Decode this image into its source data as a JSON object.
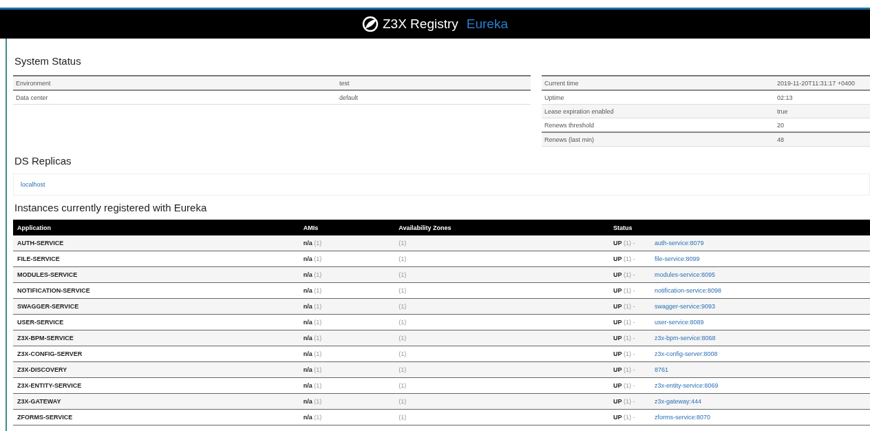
{
  "header": {
    "brand": "Z3X Registry",
    "product": "Eureka"
  },
  "system_status": {
    "title": "System Status",
    "left": [
      {
        "label": "Environment",
        "value": "test"
      },
      {
        "label": "Data center",
        "value": "default"
      }
    ],
    "right": [
      {
        "label": "Current time",
        "value": "2019-11-20T11:31:17 +0400"
      },
      {
        "label": "Uptime",
        "value": "02:13"
      },
      {
        "label": "Lease expiration enabled",
        "value": "true"
      },
      {
        "label": "Renews threshold",
        "value": "20"
      },
      {
        "label": "Renews (last min)",
        "value": "48"
      }
    ]
  },
  "replicas": {
    "title": "DS Replicas",
    "items": [
      "localhost"
    ]
  },
  "instances": {
    "title": "Instances currently registered with Eureka",
    "columns": [
      "Application",
      "AMIs",
      "Availability Zones",
      "Status"
    ],
    "rows": [
      {
        "application": "AUTH-SERVICE",
        "amis": "**n/a** (1)",
        "zones": "(1)",
        "status": "**UP** (1) -",
        "instance": "auth-service:8079"
      },
      {
        "application": "FILE-SERVICE",
        "amis": "**n/a** (1)",
        "zones": "(1)",
        "status": "**UP** (1) -",
        "instance": "file-service:8099"
      },
      {
        "application": "MODULES-SERVICE",
        "amis": "**n/a** (1)",
        "zones": "(1)",
        "status": "**UP** (1) -",
        "instance": "modules-service:8095"
      },
      {
        "application": "NOTIFICATION-SERVICE",
        "amis": "**n/a** (1)",
        "zones": "(1)",
        "status": "**UP** (1) -",
        "instance": "notification-service:8098"
      },
      {
        "application": "SWAGGER-SERVICE",
        "amis": "**n/a** (1)",
        "zones": "(1)",
        "status": "**UP** (1) -",
        "instance": "swagger-service:9093"
      },
      {
        "application": "USER-SERVICE",
        "amis": "**n/a** (1)",
        "zones": "(1)",
        "status": "**UP** (1) -",
        "instance": "user-service:8089"
      },
      {
        "application": "Z3X-BPM-SERVICE",
        "amis": "**n/a** (1)",
        "zones": "(1)",
        "status": "**UP** (1) -",
        "instance": "z3x-bpm-service:8068"
      },
      {
        "application": "Z3X-CONFIG-SERVER",
        "amis": "**n/a** (1)",
        "zones": "(1)",
        "status": "**UP** (1) -",
        "instance": "z3x-config-server:8008"
      },
      {
        "application": "Z3X-DISCOVERY",
        "amis": "**n/a** (1)",
        "zones": "(1)",
        "status": "**UP** (1) -",
        "instance": "8761"
      },
      {
        "application": "Z3X-ENTITY-SERVICE",
        "amis": "**n/a** (1)",
        "zones": "(1)",
        "status": "**UP** (1) -",
        "instance": "z3x-entity-service:8069"
      },
      {
        "application": "Z3X-GATEWAY",
        "amis": "**n/a** (1)",
        "zones": "(1)",
        "status": "**UP** (1) -",
        "instance": "z3x-gateway:444"
      },
      {
        "application": "ZFORMS-SERVICE",
        "amis": "**n/a** (1)",
        "zones": "(1)",
        "status": "**UP** (1) -",
        "instance": "zforms-service:8070"
      }
    ]
  }
}
